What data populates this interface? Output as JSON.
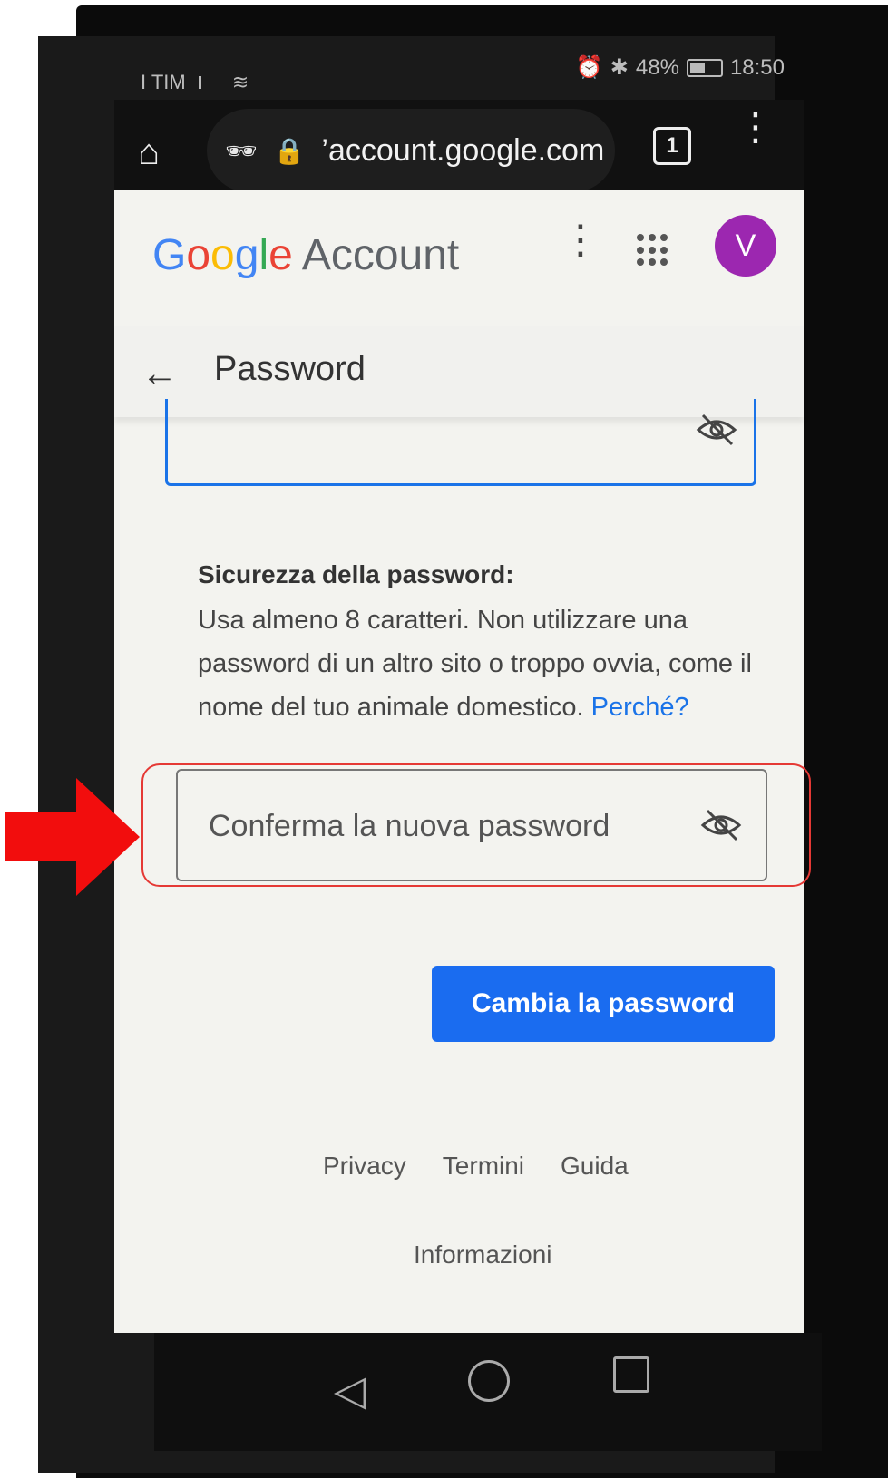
{
  "status_bar": {
    "carrier": "I TIM",
    "battery_percent": "48%",
    "time": "18:50"
  },
  "browser": {
    "url": "’account.google.com",
    "tab_count": "1"
  },
  "header": {
    "logo_letters": [
      "G",
      "o",
      "o",
      "g",
      "l",
      "e"
    ],
    "logo_suffix": "Account",
    "avatar_letter": "V"
  },
  "subheader": {
    "title": "Password"
  },
  "strength": {
    "title": "Sicurezza della password:",
    "body": "Usa almeno 8 caratteri. Non utilizzare una password di un altro sito o troppo ovvia, come il nome del tuo animale domestico.",
    "link": "Perché?"
  },
  "confirm_field": {
    "placeholder": "Conferma la nuova password"
  },
  "cta": {
    "label": "Cambia la password"
  },
  "footer": {
    "links": [
      "Privacy",
      "Termini",
      "Guida"
    ],
    "info": "Informazioni"
  },
  "colors": {
    "primary_blue": "#1a6cf0",
    "avatar_purple": "#9c27b0",
    "annotation_red": "#e53935"
  }
}
